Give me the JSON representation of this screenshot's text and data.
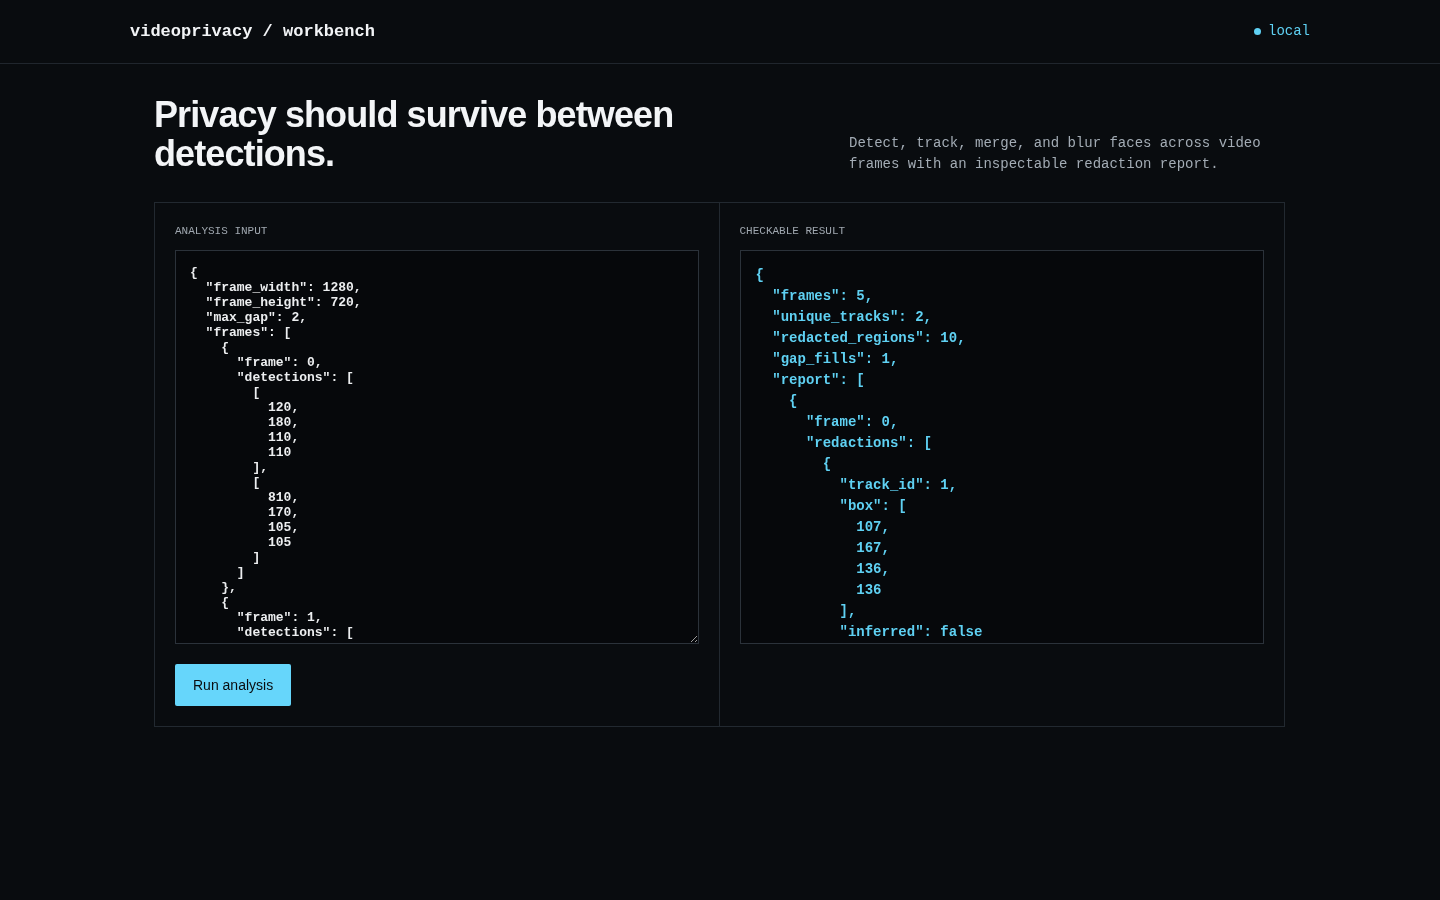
{
  "header": {
    "brand": "videoprivacy / workbench",
    "status": {
      "label": "local"
    }
  },
  "hero": {
    "title": "Privacy should survive between detections.",
    "description": "Detect, track, merge, and blur faces across video frames with an inspectable redaction report."
  },
  "input_panel": {
    "label": "ANALYSIS INPUT",
    "value": "{\n  \"frame_width\": 1280,\n  \"frame_height\": 720,\n  \"max_gap\": 2,\n  \"frames\": [\n    {\n      \"frame\": 0,\n      \"detections\": [\n        [\n          120,\n          180,\n          110,\n          110\n        ],\n        [\n          810,\n          170,\n          105,\n          105\n        ]\n      ]\n    },\n    {\n      \"frame\": 1,\n      \"detections\": [",
    "button": "Run analysis"
  },
  "result_panel": {
    "label": "CHECKABLE RESULT",
    "text": "{\n  \"frames\": 5,\n  \"unique_tracks\": 2,\n  \"redacted_regions\": 10,\n  \"gap_fills\": 1,\n  \"report\": [\n    {\n      \"frame\": 0,\n      \"redactions\": [\n        {\n          \"track_id\": 1,\n          \"box\": [\n            107,\n            167,\n            136,\n            136\n          ],\n          \"inferred\": false"
  }
}
